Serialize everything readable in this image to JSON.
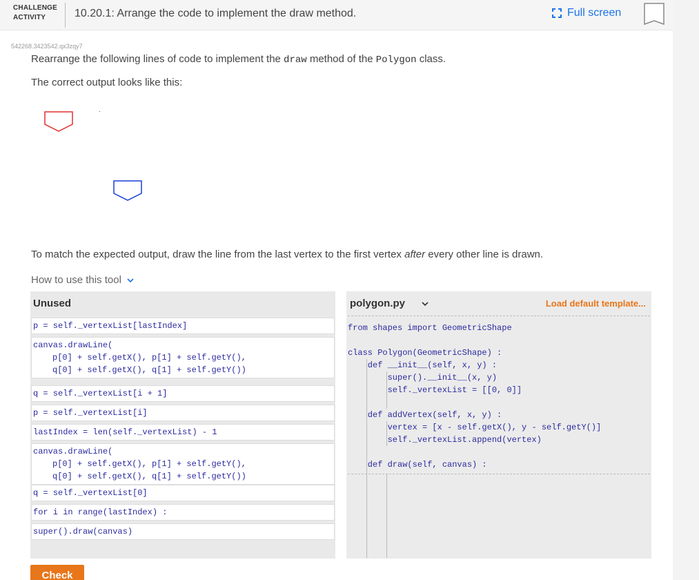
{
  "header": {
    "badge_line1": "CHALLENGE",
    "badge_line2": "ACTIVITY",
    "title": "10.20.1: Arrange the code to implement the draw method.",
    "fullscreen_label": "Full screen",
    "icons": {
      "fullscreen": "fullscreen-icon",
      "bookmark": "bookmark-icon"
    }
  },
  "activity_id": "542268.3423542.qx3zqy7",
  "instructions": {
    "prefix": "Rearrange the following lines of code to implement the ",
    "code1": "draw",
    "middle": " method of the ",
    "code2": "Polygon",
    "suffix": " class."
  },
  "output_label": "The correct output looks like this:",
  "output_colors": {
    "shape1": "#e03030",
    "shape2": "#1a3fd6"
  },
  "hint": {
    "prefix": "To match the expected output, draw the line from the last vertex to the first vertex ",
    "emph": "after",
    "suffix": " every other line is drawn."
  },
  "howto_label": "How to use this tool",
  "unused": {
    "title": "Unused",
    "blocks": [
      {
        "lines": [
          "p = self._vertexList[lastIndex]"
        ]
      },
      {
        "lines": [
          "canvas.drawLine(",
          "p[0] + self.getX(), p[1] + self.getY(),",
          "q[0] + self.getX(), q[1] + self.getY())"
        ]
      },
      {
        "lines": [
          "q = self._vertexList[i + 1]"
        ]
      },
      {
        "lines": [
          "p = self._vertexList[i]"
        ]
      },
      {
        "lines": [
          "lastIndex = len(self._vertexList) - 1"
        ]
      },
      {
        "lines": [
          "canvas.drawLine(",
          "p[0] + self.getX(), p[1] + self.getY(),",
          "q[0] + self.getX(), q[1] + self.getY())"
        ]
      },
      {
        "lines": [
          "q = self._vertexList[0]"
        ]
      },
      {
        "lines": [
          "for i in range(lastIndex) :"
        ]
      },
      {
        "lines": [
          "super().draw(canvas)"
        ]
      }
    ]
  },
  "code_pane": {
    "file": "polygon.py",
    "load_default": "Load default template...",
    "lines": [
      "from shapes import GeometricShape",
      "",
      "class Polygon(GeometricShape) :",
      "    def __init__(self, x, y) :",
      "        super().__init__(x, y)",
      "        self._vertexList = [[0, 0]]",
      "",
      "    def addVertex(self, x, y) :",
      "        vertex = [x - self.getX(), y - self.getY()]",
      "        self._vertexList.append(vertex)",
      "",
      "    def draw(self, canvas) :"
    ]
  },
  "check_label": "Check"
}
